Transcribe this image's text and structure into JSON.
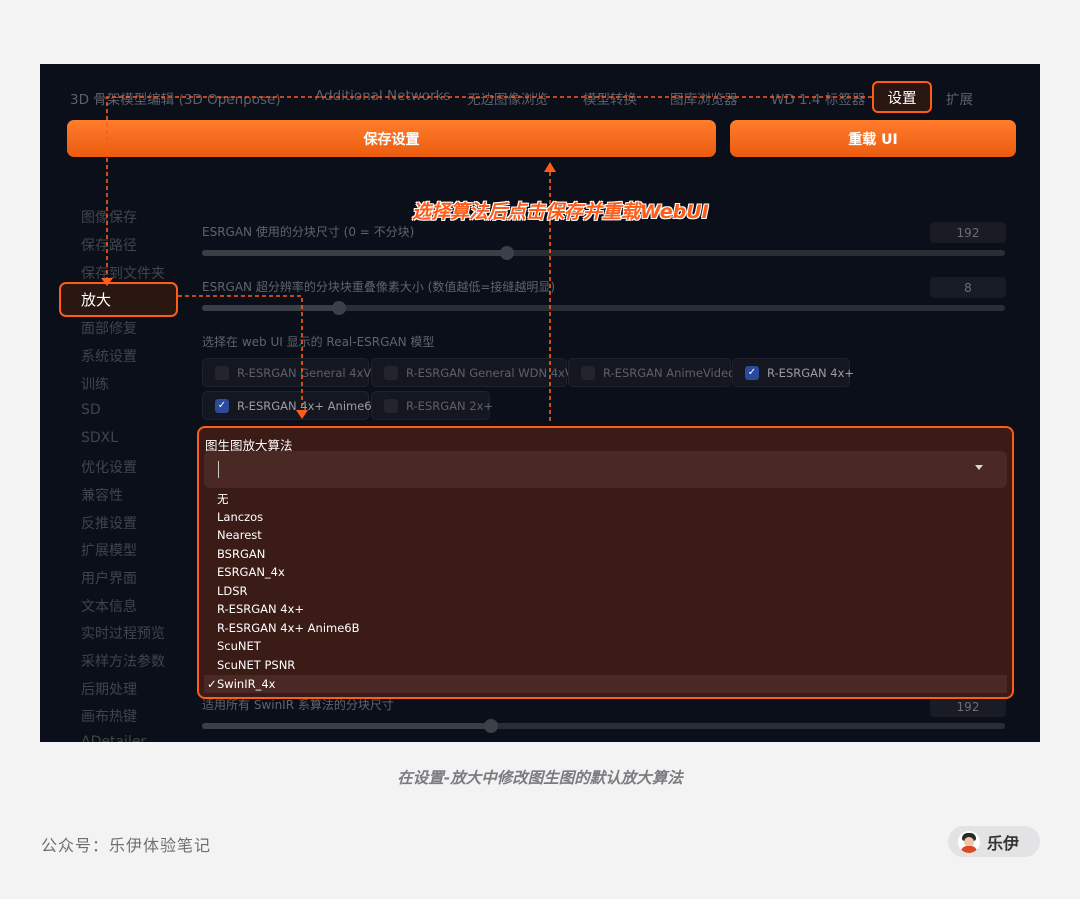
{
  "tabs": [
    {
      "label": "3D 骨架模型编辑 (3D Openpose)"
    },
    {
      "label": "Additional Networks"
    },
    {
      "label": "无边图像浏览"
    },
    {
      "label": "模型转换"
    },
    {
      "label": "图库浏览器"
    },
    {
      "label": "WD 1.4 标签器"
    },
    {
      "label": "设置"
    },
    {
      "label": "扩展"
    }
  ],
  "buttons": {
    "save": "保存设置",
    "reload": "重载 UI"
  },
  "annotation": "选择算法后点击保存并重载WebUI",
  "sidebar": {
    "items": [
      {
        "label": "图像保存"
      },
      {
        "label": "保存路径"
      },
      {
        "label": "保存到文件夹"
      },
      {
        "label": "放大"
      },
      {
        "label": "面部修复"
      },
      {
        "label": "系统设置"
      },
      {
        "label": "训练"
      },
      {
        "label": "SD"
      },
      {
        "label": "SDXL"
      },
      {
        "label": "优化设置"
      },
      {
        "label": "兼容性"
      },
      {
        "label": "反推设置"
      },
      {
        "label": "扩展模型"
      },
      {
        "label": "用户界面"
      },
      {
        "label": "文本信息"
      },
      {
        "label": "实时过程预览"
      },
      {
        "label": "采样方法参数"
      },
      {
        "label": "后期处理"
      },
      {
        "label": "画布热键"
      },
      {
        "label": "ADetailer"
      }
    ],
    "active": "放大"
  },
  "settings": {
    "tile_size": {
      "label": "ESRGAN 使用的分块尺寸 (0 = 不分块)",
      "value": "192",
      "fraction": 0.38
    },
    "tile_overlap": {
      "label": "ESRGAN 超分辨率的分块块重叠像素大小 (数值越低=接缝越明显)",
      "value": "8",
      "fraction": 0.17
    },
    "models_label": "选择在 web UI 显示的 Real-ESRGAN 模型",
    "models": [
      {
        "label": "R-ESRGAN General 4xV3",
        "checked": false
      },
      {
        "label": "R-ESRGAN General WDN 4xV3",
        "checked": false
      },
      {
        "label": "R-ESRGAN AnimeVideo",
        "checked": false
      },
      {
        "label": "R-ESRGAN 4x+",
        "checked": true
      },
      {
        "label": "R-ESRGAN 4x+ Anime6B",
        "checked": true
      },
      {
        "label": "R-ESRGAN 2x+",
        "checked": false
      }
    ],
    "swinir": {
      "label": "适用所有 SwinIR 系算法的分块尺寸",
      "value": "192",
      "fraction": 0.36
    }
  },
  "img2img_upscaler": {
    "label": "图生图放大算法",
    "input_value": "",
    "options": [
      "无",
      "Lanczos",
      "Nearest",
      "BSRGAN",
      "ESRGAN_4x",
      "LDSR",
      "R-ESRGAN 4x+",
      "R-ESRGAN 4x+ Anime6B",
      "ScuNET",
      "ScuNET PSNR",
      "SwinIR_4x"
    ],
    "selected": "SwinIR_4x",
    "check_glyph": "✓"
  },
  "caption": "在设置-放大中修改图生图的默认放大算法",
  "footer": {
    "account": "公众号：乐伊体验笔记",
    "author": "乐伊"
  },
  "colors": {
    "accent": "#ff5c1a",
    "button": "#f06a1e",
    "background": "#0b0f19",
    "dropdown": "#3a1b16"
  }
}
